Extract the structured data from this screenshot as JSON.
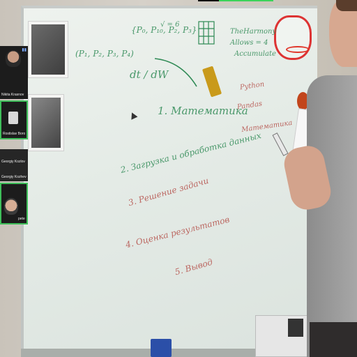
{
  "participants": [
    {
      "name": "Nikita Krasnov",
      "active": false
    },
    {
      "name": "Rostislav Borovikov",
      "active": true
    },
    {
      "name": "Georgiy Kozlov",
      "active": false
    },
    {
      "name": "Georgiy Kozhevnikov",
      "active": false
    },
    {
      "name": "peter",
      "active": true
    }
  ],
  "whiteboard": {
    "lines": [
      "{P₀, P₁₀, P₂, P₃}",
      "(P₁, P₂, P₃, P₄)",
      "√ = 6",
      "TheHarmony",
      "Allows = 4",
      "Accumulate",
      "dt / dW",
      "1. Математика",
      "2. Загрузка и обработка данных",
      "3. Решение задачи",
      "4. Оценка результатов",
      "5. Вывод"
    ],
    "side_notes": [
      "Python",
      "Pandas",
      "Математика"
    ]
  },
  "colors": {
    "ink_green": "#2f8a55",
    "ink_red": "#b5504a",
    "active_border": "#3fbf5a"
  }
}
